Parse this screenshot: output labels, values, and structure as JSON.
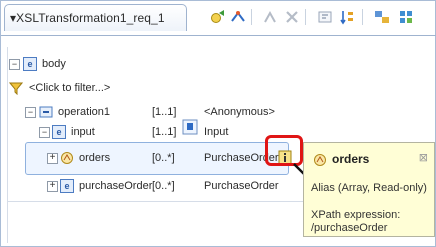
{
  "editor": {
    "tab_title": "▾XSLTransformation1_req_1"
  },
  "tree": {
    "root_label": "body",
    "filter_label": "<Click to filter...>",
    "rows": [
      {
        "name": "operation1",
        "cardinality": "[1..1]",
        "type": "<Anonymous>"
      },
      {
        "name": "input",
        "cardinality": "[1..1]",
        "type": "Input"
      },
      {
        "name": "orders",
        "cardinality": "[0..*]",
        "type": "PurchaseOrder"
      },
      {
        "name": "purchaseOrder",
        "cardinality": "[0..*]",
        "type": "PurchaseOrder"
      }
    ]
  },
  "tooltip": {
    "title": "orders",
    "alias": "Alias (Array, Read-only)",
    "xpath_label": "XPath expression:",
    "xpath_value": "/purchaseOrder"
  },
  "colors": {
    "highlight": "#e01515",
    "tooltip_bg": "#fffed6",
    "selection": "#eef5ff"
  }
}
